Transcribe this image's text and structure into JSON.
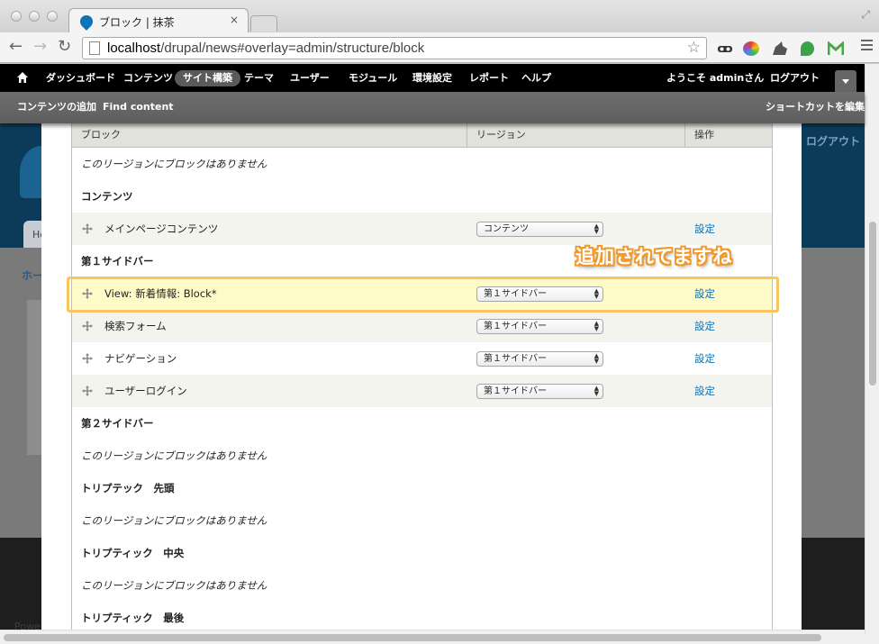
{
  "browser": {
    "tab_title": "ブロック | 抹茶",
    "tab_close": "×",
    "url_host": "localhost",
    "url_path": "/drupal/news#overlay=admin/structure/block",
    "fullscreen_icon": "⤢",
    "back_icon": "←",
    "forward_icon": "→",
    "reload_icon": "↻",
    "star_icon": "☆",
    "extensions": [
      {
        "name": "mask-extension-icon",
        "color": "#333333"
      },
      {
        "name": "colorwheel-extension-icon",
        "color": "#e0413a"
      },
      {
        "name": "rhino-extension-icon",
        "color": "#555555"
      },
      {
        "name": "evernote-extension-icon",
        "color": "#3aa34a"
      },
      {
        "name": "gmail-extension-icon",
        "color": "#49a94a"
      }
    ]
  },
  "toolbar": {
    "home_icon": "home-icon",
    "items": [
      "ダッシュボード",
      "コンテンツ",
      "サイト構築",
      "テーマ",
      "ユーザー",
      "モジュール",
      "環境設定",
      "レポート",
      "ヘルプ"
    ],
    "active_item": "サイト構築",
    "welcome": "ようこそ adminさん",
    "logout": "ログアウト"
  },
  "shortcuts": {
    "items": [
      "コンテンツの追加",
      "Find content"
    ],
    "edit": "ショートカットを編集"
  },
  "site_background": {
    "logout": "ログアウト",
    "tab_label": "He",
    "home_link": "ホー",
    "footer_text": "Powe"
  },
  "table": {
    "headers": [
      "ブロック",
      "リージョン",
      "操作"
    ],
    "rows": [
      {
        "kind": "message",
        "text": "このリージョンにブロックはありません"
      },
      {
        "kind": "region",
        "text": "コンテンツ"
      },
      {
        "kind": "block",
        "text": "メインページコンテンツ",
        "region": "コンテンツ",
        "link": "設定"
      },
      {
        "kind": "region",
        "text": "第１サイドバー"
      },
      {
        "kind": "block",
        "text": "View: 新着情報: Block*",
        "region": "第１サイドバー",
        "link": "設定",
        "highlight": true
      },
      {
        "kind": "block",
        "text": "検索フォーム",
        "region": "第１サイドバー",
        "link": "設定"
      },
      {
        "kind": "block",
        "text": "ナビゲーション",
        "region": "第１サイドバー",
        "link": "設定"
      },
      {
        "kind": "block",
        "text": "ユーザーログイン",
        "region": "第１サイドバー",
        "link": "設定"
      },
      {
        "kind": "region",
        "text": "第２サイドバー"
      },
      {
        "kind": "message",
        "text": "このリージョンにブロックはありません"
      },
      {
        "kind": "region",
        "text": "トリプテック　先頭"
      },
      {
        "kind": "message",
        "text": "このリージョンにブロックはありません"
      },
      {
        "kind": "region",
        "text": "トリプティック　中央"
      },
      {
        "kind": "message",
        "text": "このリージョンにブロックはありません"
      },
      {
        "kind": "region",
        "text": "トリプティック　最後"
      }
    ]
  },
  "annotation": {
    "text": "追加されてますね",
    "color": "#f0992c"
  }
}
